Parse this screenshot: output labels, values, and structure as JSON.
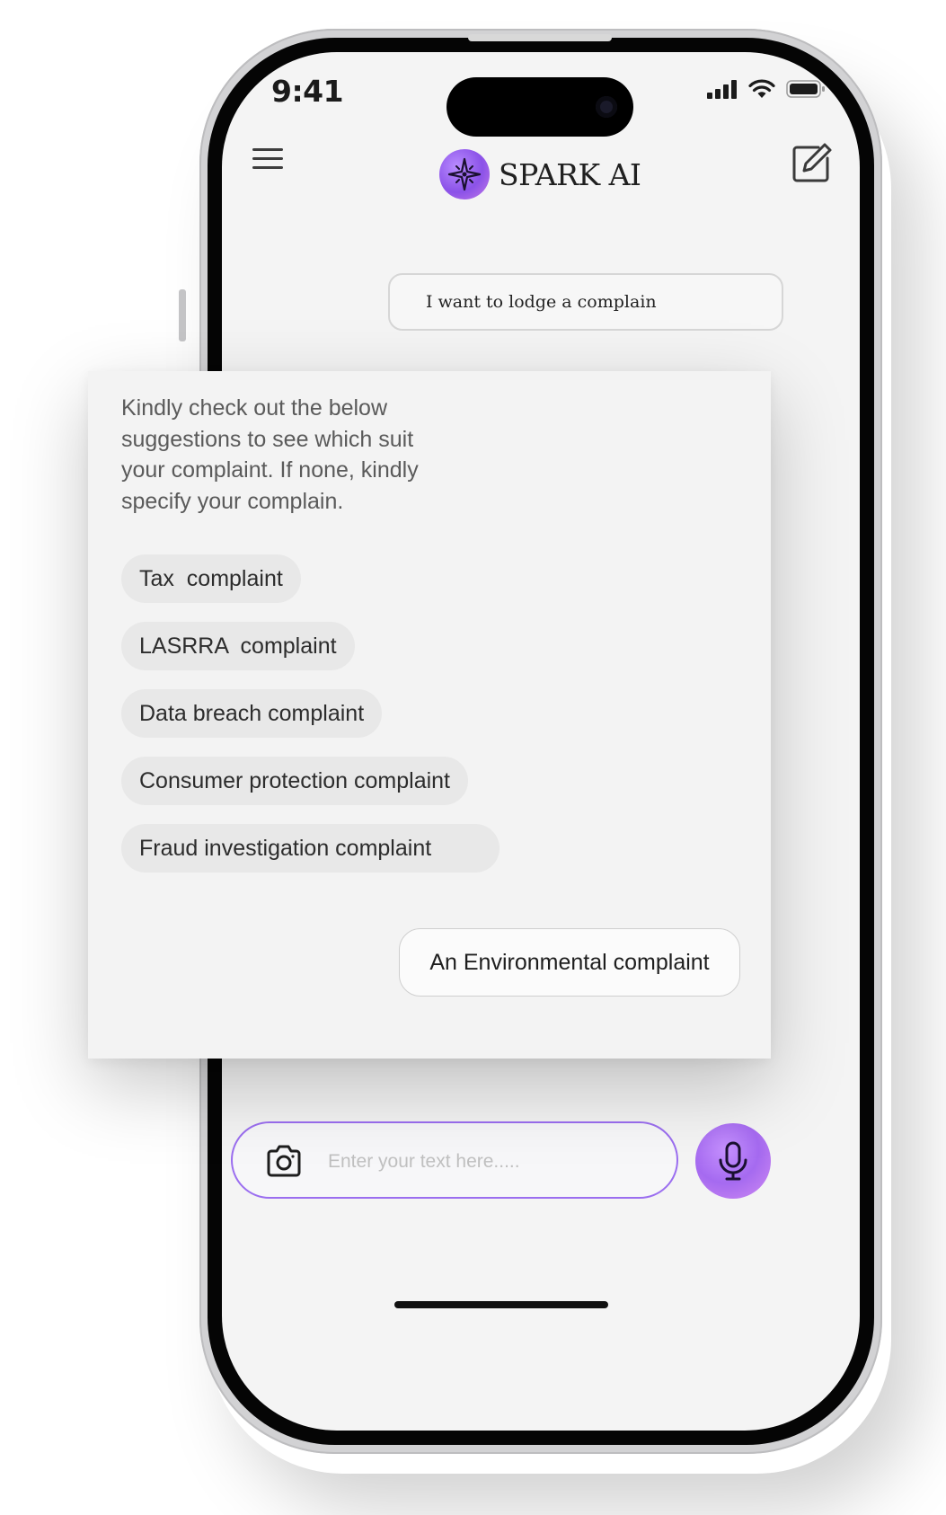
{
  "status_bar": {
    "time": "9:41",
    "icons": [
      "signal-icon",
      "wifi-icon",
      "battery-icon"
    ]
  },
  "header": {
    "brand_name": "SPARK AI",
    "icons": [
      "menu-icon",
      "spark-logo-icon",
      "edit-icon"
    ]
  },
  "chat": {
    "user_message": "I want to lodge a complain",
    "bot_message": "Kindly check out the below suggestions to see which suit your complaint. If none, kindly specify your complain.",
    "suggestions": [
      "Tax  complaint",
      "LASRRA  complaint",
      "Data breach complaint",
      "Consumer protection complaint",
      "Fraud investigation complaint"
    ],
    "user_reply": "An Environmental complaint"
  },
  "composer": {
    "placeholder": "Enter your text here.....",
    "icons": [
      "camera-icon",
      "microphone-icon"
    ]
  },
  "colors": {
    "accent": "#9b6ef0",
    "screen_bg": "#f4f4f4",
    "chip_bg": "#e8e8e8"
  }
}
